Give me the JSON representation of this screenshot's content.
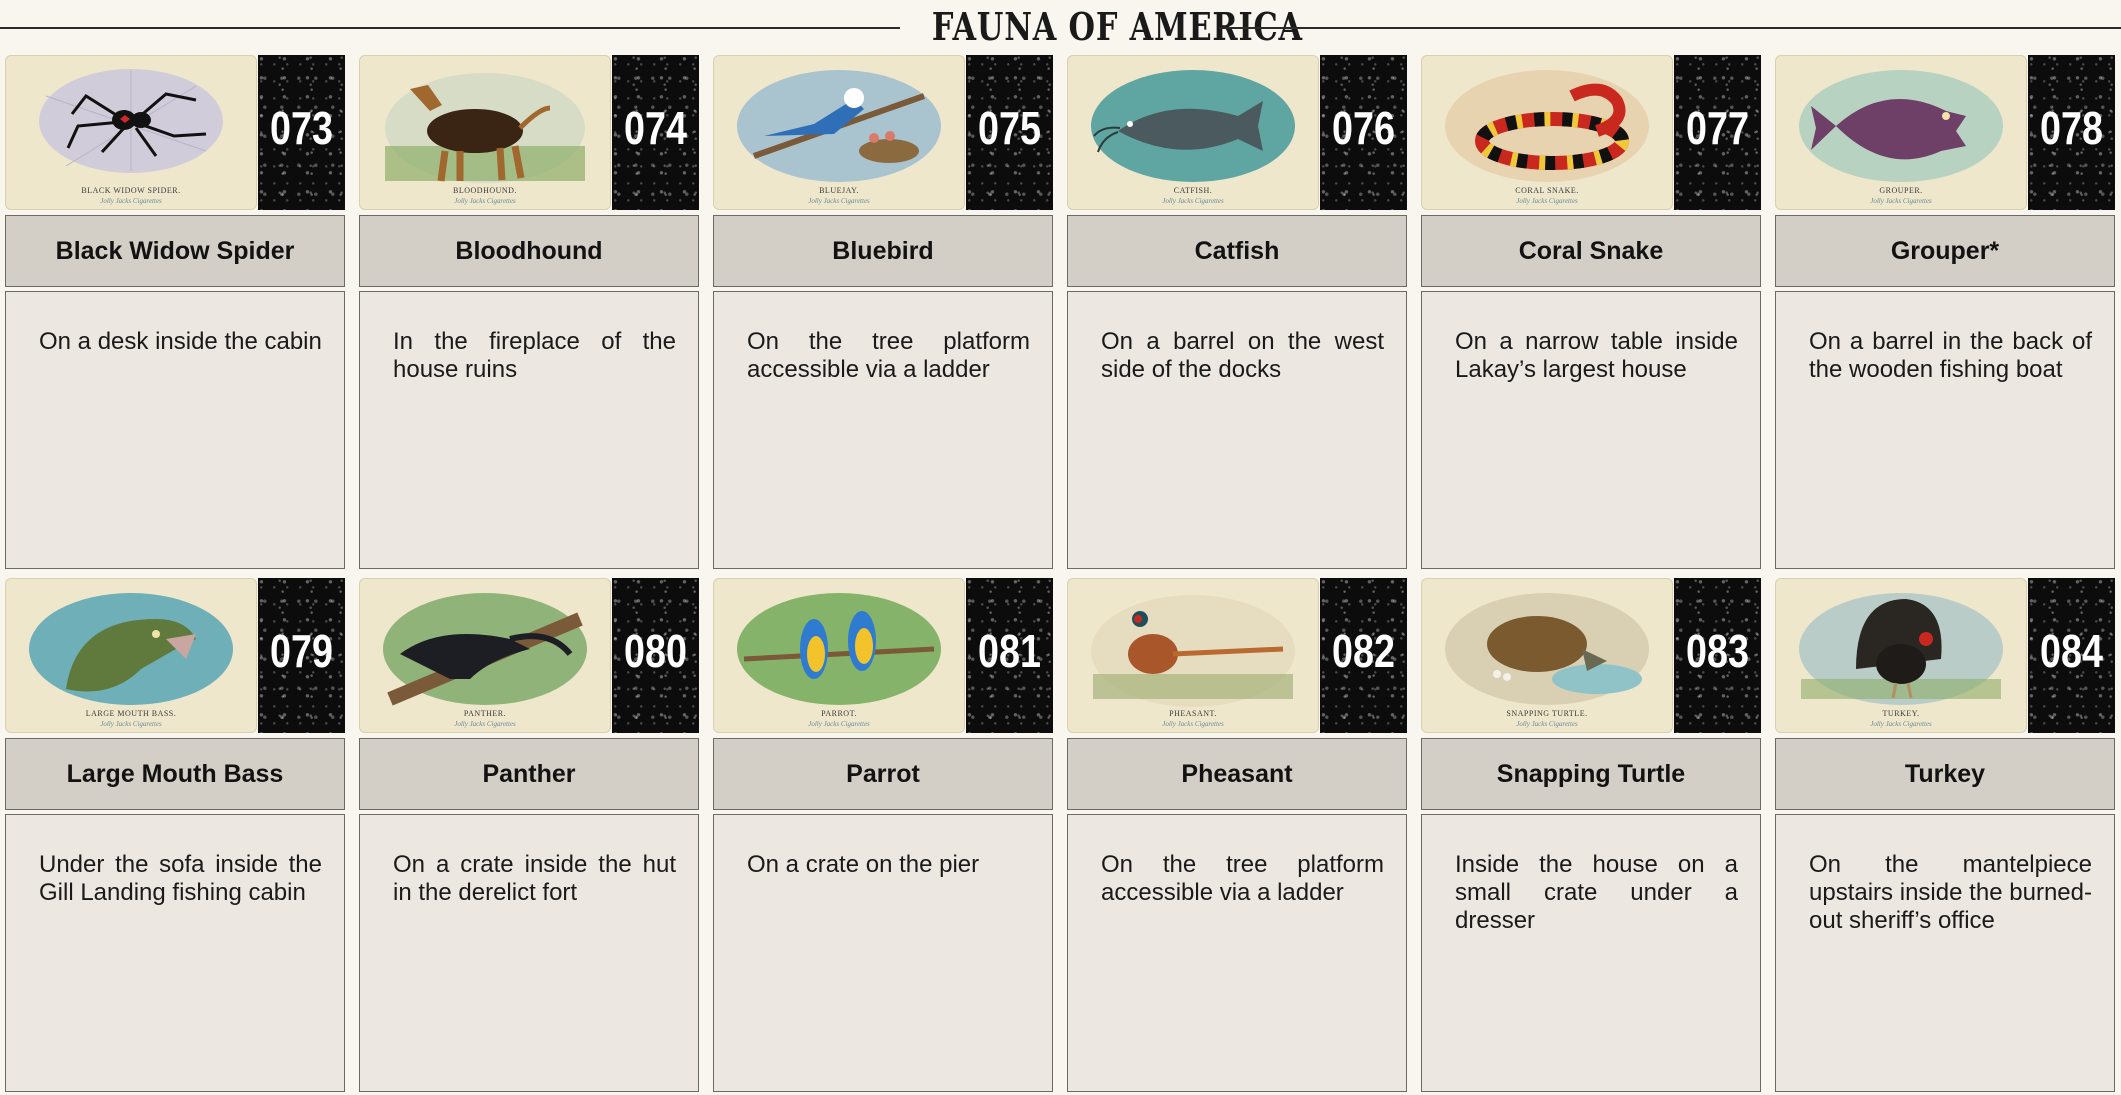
{
  "page": {
    "title": "FAUNA OF AMERICA"
  },
  "cards": [
    {
      "number": "073",
      "name": "Black Widow Spider",
      "caption": "BLACK WIDOW SPIDER.",
      "brand": "Jolly Jacks Cigarettes",
      "location": "On a desk inside the cabin"
    },
    {
      "number": "074",
      "name": "Bloodhound",
      "caption": "BLOODHOUND.",
      "brand": "Jolly Jacks Cigarettes",
      "location": "In the fireplace of the house ruins"
    },
    {
      "number": "075",
      "name": "Bluebird",
      "caption": "BLUEJAY.",
      "brand": "Jolly Jacks Cigarettes",
      "location": "On the tree platform accessible via a ladder"
    },
    {
      "number": "076",
      "name": "Catfish",
      "caption": "CATFISH.",
      "brand": "Jolly Jacks Cigarettes",
      "location": "On a barrel on the west side of the docks"
    },
    {
      "number": "077",
      "name": "Coral Snake",
      "caption": "CORAL SNAKE.",
      "brand": "Jolly Jacks Cigarettes",
      "location": "On a narrow table inside Lakay’s largest house"
    },
    {
      "number": "078",
      "name": "Grouper*",
      "caption": "GROUPER.",
      "brand": "Jolly Jacks Cigarettes",
      "location": "On a barrel in the back of the wooden fishing boat"
    },
    {
      "number": "079",
      "name": "Large Mouth Bass",
      "caption": "LARGE MOUTH BASS.",
      "brand": "Jolly Jacks Cigarettes",
      "location": "Under the sofa inside the Gill Landing fishing cabin"
    },
    {
      "number": "080",
      "name": "Panther",
      "caption": "PANTHER.",
      "brand": "Jolly Jacks Cigarettes",
      "location": "On a crate inside the hut in the derelict fort"
    },
    {
      "number": "081",
      "name": "Parrot",
      "caption": "PARROT.",
      "brand": "Jolly Jacks Cigarettes",
      "location": "On a crate on the pier"
    },
    {
      "number": "082",
      "name": "Pheasant",
      "caption": "PHEASANT.",
      "brand": "Jolly Jacks Cigarettes",
      "location": "On the tree platform accessible via a ladder"
    },
    {
      "number": "083",
      "name": "Snapping Turtle",
      "caption": "SNAPPING TURTLE.",
      "brand": "Jolly Jacks Cigarettes",
      "location": "Inside the house on a small crate under a dresser"
    },
    {
      "number": "084",
      "name": "Turkey",
      "caption": "TURKEY.",
      "brand": "Jolly Jacks Cigarettes",
      "location": "On the mantelpiece upstairs inside the burned-out sheriff’s office"
    }
  ]
}
